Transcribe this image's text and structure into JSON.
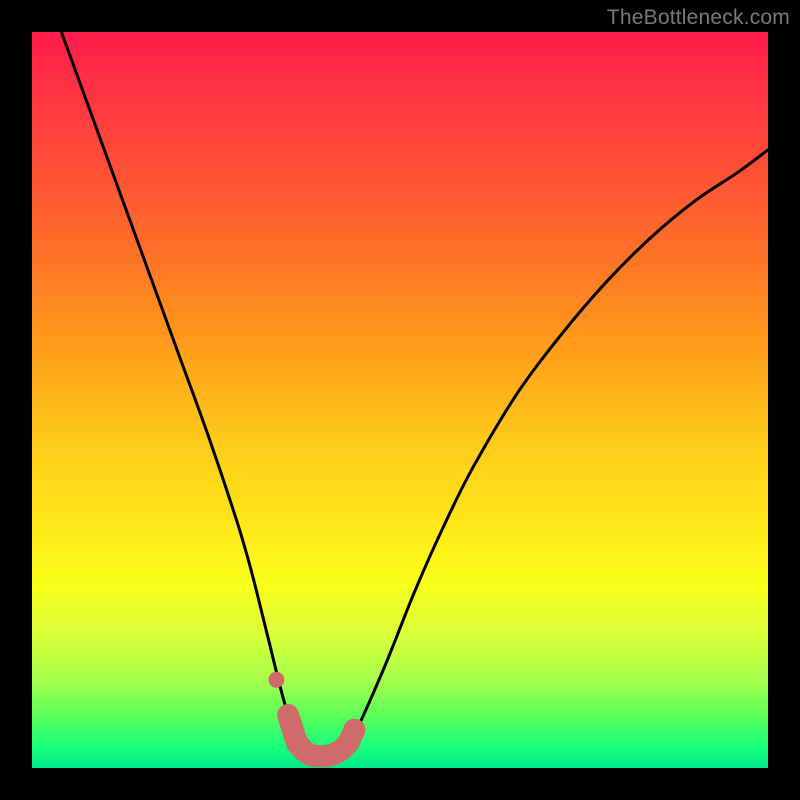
{
  "watermark": "TheBottleneck.com",
  "colors": {
    "frame": "#000000",
    "gradient_top": "#ff1c4b",
    "gradient_bottom": "#00e88a",
    "curve_stroke": "#000000",
    "marker_fill": "#cf6b6b",
    "marker_stroke": "#cf6b6b"
  },
  "chart_data": {
    "type": "line",
    "title": "",
    "xlabel": "",
    "ylabel": "",
    "xlim": [
      0,
      100
    ],
    "ylim": [
      0,
      100
    ],
    "grid": false,
    "legend": false,
    "series": [
      {
        "name": "bottleneck-curve",
        "x": [
          4,
          8,
          12,
          16,
          20,
          24,
          28,
          30,
          32,
          34,
          35.5,
          37,
          38.5,
          40,
          42,
          44,
          48,
          52,
          56,
          60,
          66,
          72,
          78,
          84,
          90,
          96,
          100
        ],
        "y": [
          100,
          89,
          78,
          67,
          56,
          45,
          33,
          26,
          18,
          10,
          5,
          2.4,
          1.5,
          1.5,
          2.2,
          5,
          14,
          24,
          33,
          41,
          51,
          59,
          66,
          72,
          77,
          81,
          84
        ]
      }
    ],
    "markers": {
      "name": "optimal-zone",
      "x": [
        34.8,
        36.0,
        37.0,
        38.0,
        39.0,
        40.0,
        41.0,
        42.0,
        43.0,
        43.8
      ],
      "y": [
        7.2,
        3.4,
        2.3,
        1.7,
        1.6,
        1.6,
        1.9,
        2.4,
        3.4,
        5.2
      ],
      "dot": {
        "x": 33.2,
        "y": 12.0
      }
    }
  }
}
